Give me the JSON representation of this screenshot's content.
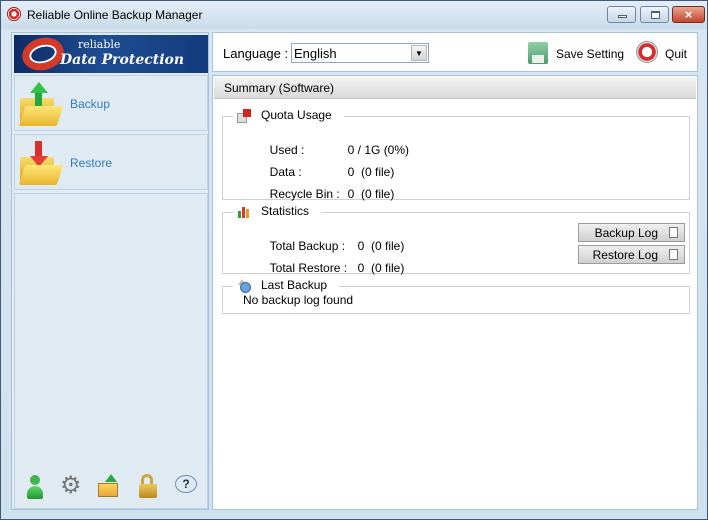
{
  "window": {
    "title": "Reliable Online Backup Manager",
    "controls": {
      "minimize": "minimize",
      "maximize": "maximize",
      "close": "×"
    }
  },
  "logo": {
    "line1": "reliable",
    "line2": "Data Protection"
  },
  "sidebar": {
    "items": [
      {
        "label": "Backup",
        "icon": "folder-upload-icon"
      },
      {
        "label": "Restore",
        "icon": "folder-download-icon"
      }
    ],
    "bottom_icons": [
      "user-icon",
      "gear-icon",
      "backup-set-icon",
      "lock-icon",
      "help-icon"
    ],
    "help_glyph": "?"
  },
  "toolbar": {
    "language_label": "Language :",
    "language_value": "English",
    "dropdown_glyph": "▼",
    "save_label": "Save Setting",
    "quit_label": "Quit"
  },
  "main": {
    "header": "Summary (Software)",
    "quota": {
      "title": "Quota Usage",
      "rows": [
        {
          "key": "Used :",
          "value": "0 / 1G (0%)"
        },
        {
          "key": "Data :",
          "value": "0  (0 file)"
        },
        {
          "key": "Recycle Bin :",
          "value": "0  (0 file)"
        }
      ]
    },
    "statistics": {
      "title": "Statistics",
      "rows": [
        {
          "key": "Total Backup :",
          "value": "0  (0 file)"
        },
        {
          "key": "Total Restore :",
          "value": "0  (0 file)"
        }
      ],
      "backup_log_label": "Backup Log",
      "restore_log_label": "Restore Log"
    },
    "last_backup": {
      "title": "Last Backup",
      "message": "No backup log found"
    }
  }
}
